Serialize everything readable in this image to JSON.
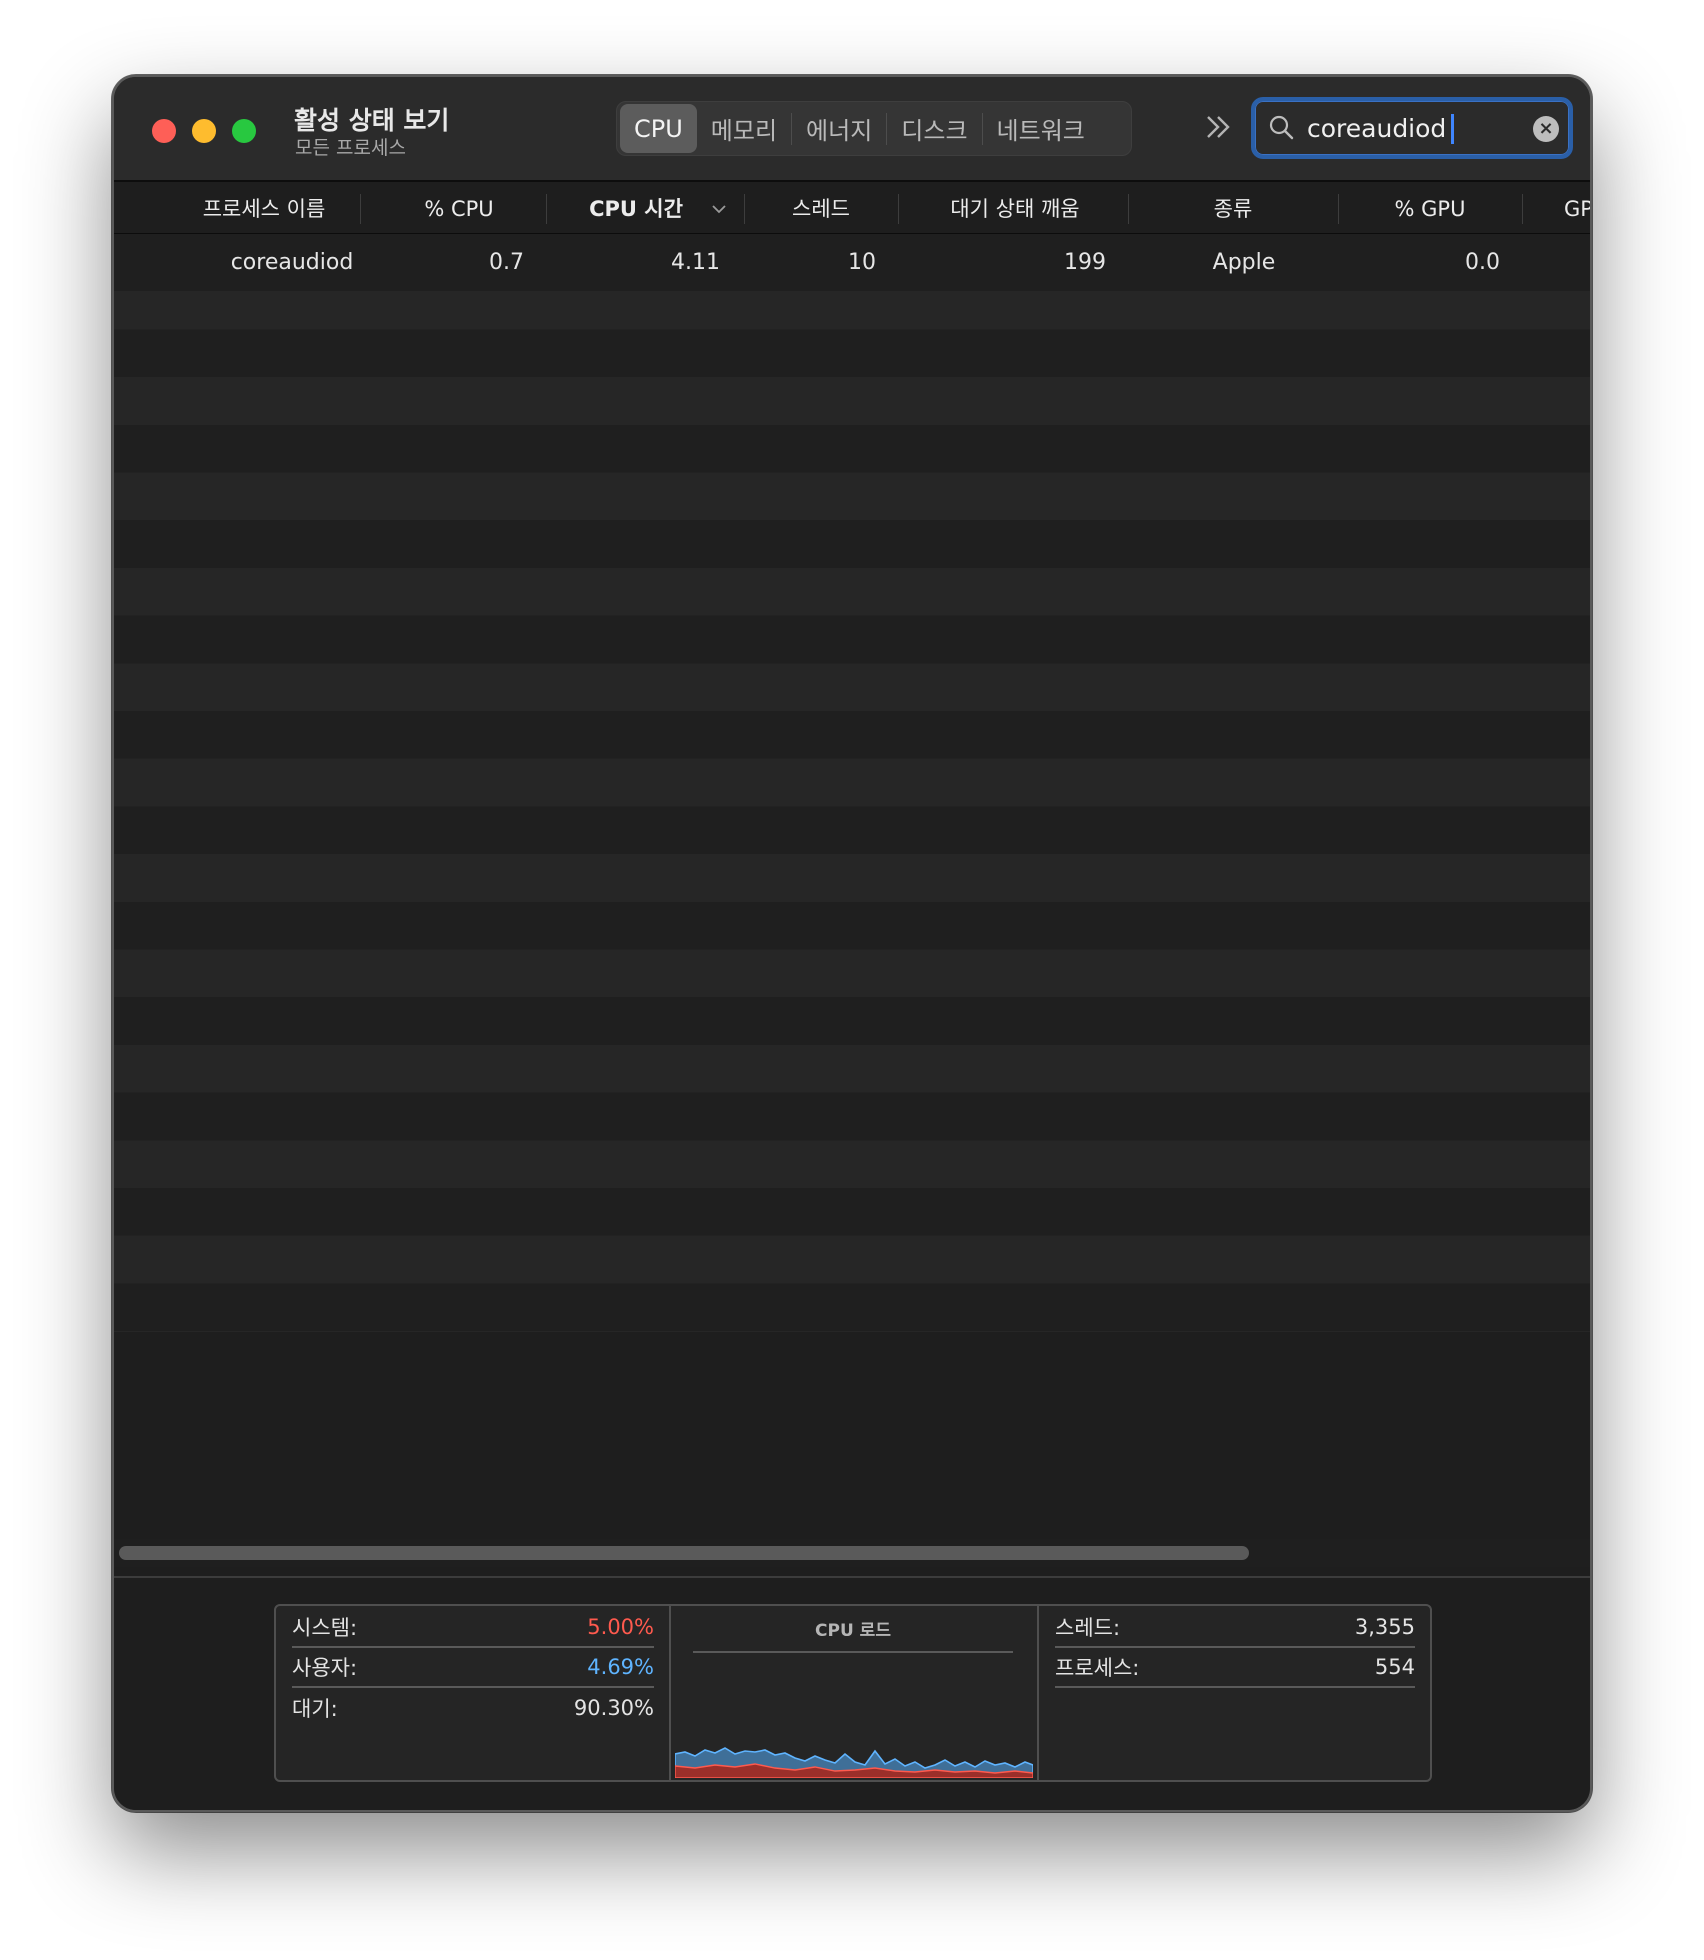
{
  "window": {
    "title": "활성 상태 보기",
    "subtitle": "모든 프로세스"
  },
  "tabs": [
    {
      "label": "CPU",
      "active": true
    },
    {
      "label": "메모리",
      "active": false
    },
    {
      "label": "에너지",
      "active": false
    },
    {
      "label": "디스크",
      "active": false
    },
    {
      "label": "네트워크",
      "active": false
    }
  ],
  "search": {
    "value": "coreaudiod",
    "placeholder": "검색"
  },
  "columns": {
    "process_name": "프로세스 이름",
    "cpu_percent": "% CPU",
    "cpu_time": "CPU 시간",
    "threads": "스레드",
    "idle_wakeups": "대기 상태 깨움",
    "kind": "종류",
    "gpu_percent": "% GPU",
    "gpu_partial": "GP"
  },
  "rows": [
    {
      "process_name": "coreaudiod",
      "cpu_percent": "0.7",
      "cpu_time": "4.11",
      "threads": "10",
      "idle_wakeups": "199",
      "kind": "Apple",
      "gpu_percent": "0.0"
    }
  ],
  "stats": {
    "system_label": "시스템:",
    "system_value": "5.00%",
    "user_label": "사용자:",
    "user_value": "4.69%",
    "idle_label": "대기:",
    "idle_value": "90.30%",
    "cpu_load_title": "CPU 로드",
    "threads_label": "스레드:",
    "threads_value": "3,355",
    "processes_label": "프로세스:",
    "processes_value": "554"
  },
  "colors": {
    "system": "#ff5a4e",
    "user": "#5fb4ff",
    "accent": "#2a5fa8"
  }
}
